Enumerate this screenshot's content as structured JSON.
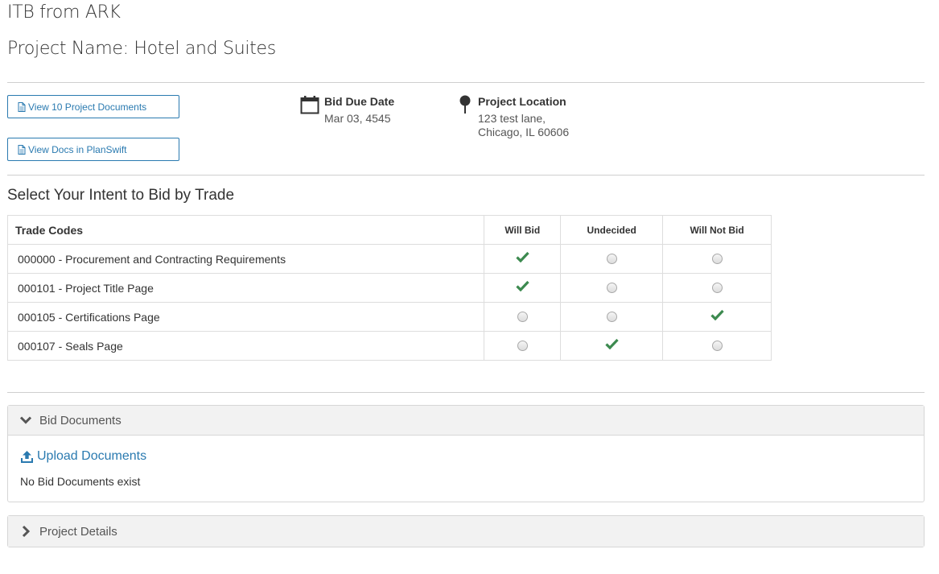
{
  "header": {
    "itb_title": "ITB from ARK",
    "project_name": "Project Name: Hotel and Suites"
  },
  "actions": {
    "view_docs_label": "View 10 Project Documents",
    "planswift_label": "View Docs in PlanSwift"
  },
  "bid_due": {
    "label": "Bid Due Date",
    "value": "Mar 03, 4545"
  },
  "location": {
    "label": "Project Location",
    "line1": "123 test lane,",
    "line2": "Chicago, IL 60606"
  },
  "intent": {
    "heading": "Select Your Intent to Bid by Trade",
    "columns": [
      "Trade Codes",
      "Will Bid",
      "Undecided",
      "Will Not Bid"
    ],
    "rows": [
      {
        "code": "000000 - Procurement and Contracting Requirements",
        "selected": "Will Bid"
      },
      {
        "code": "000101 - Project Title Page",
        "selected": "Will Bid"
      },
      {
        "code": "000105 - Certifications Page",
        "selected": "Will Not Bid"
      },
      {
        "code": "000107 - Seals Page",
        "selected": "Undecided"
      }
    ]
  },
  "bid_documents": {
    "title": "Bid Documents",
    "upload_label": "Upload Documents",
    "empty_text": "No Bid Documents exist"
  },
  "project_details": {
    "title": "Project Details"
  },
  "colors": {
    "link": "#2a7ab0",
    "check": "#3c8a4f"
  },
  "icons": {
    "doc": "file-icon",
    "calendar": "calendar-icon",
    "location": "map-pin-icon",
    "upload": "upload-icon",
    "expanded": "chevron-down-icon",
    "collapsed": "chevron-right-icon"
  }
}
